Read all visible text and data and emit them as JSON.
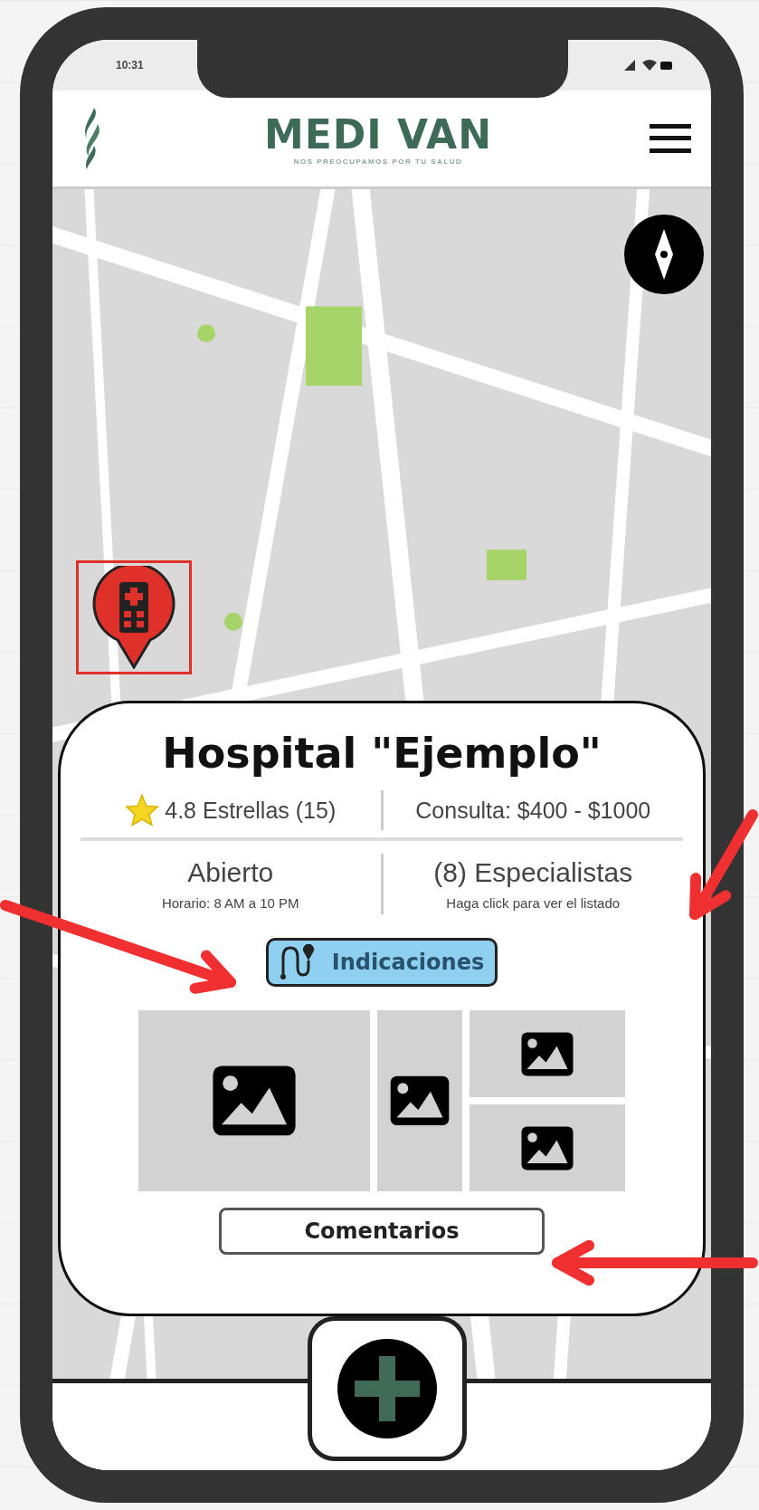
{
  "status_bar": {
    "time": "10:31"
  },
  "header": {
    "title": "MEDI VAN",
    "tagline": "NOS PREOCUPAMOS POR TU SALUD"
  },
  "map": {
    "kind": "picture",
    "marker": {
      "selected": true
    }
  },
  "place_card": {
    "title": "Hospital \"Ejemplo\"",
    "rating": "4.8 Estrellas (15)",
    "price": "Consulta: $400 - $1000",
    "status": "Abierto",
    "hours": "Horario: 8 AM a 10 PM",
    "specialists": "(8) Especialistas",
    "specialists_hint": "Haga click para ver el listado",
    "directions_button": "Indicaciones",
    "comments_button": "Comentarios"
  }
}
